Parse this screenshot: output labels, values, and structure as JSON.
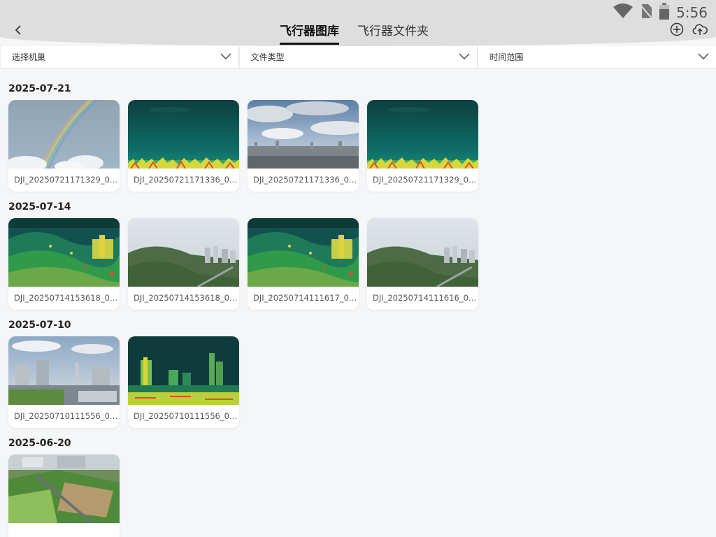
{
  "status": {
    "time": "5:56"
  },
  "header": {
    "tabs": [
      {
        "label": "飞行器图库",
        "active": true
      },
      {
        "label": "飞行器文件夹",
        "active": false
      }
    ],
    "icons": {
      "back": "chevron-left-icon",
      "add": "plus-circle-icon",
      "upload": "cloud-upload-icon"
    }
  },
  "filters": [
    {
      "label": "选择机巢"
    },
    {
      "label": "文件类型"
    },
    {
      "label": "时间范围"
    }
  ],
  "groups": [
    {
      "date": "2025-07-21",
      "items": [
        {
          "name": "DJI_20250721171329_0…",
          "kind": "rainbow"
        },
        {
          "name": "DJI_20250721171336_0…",
          "kind": "thermal-sky"
        },
        {
          "name": "DJI_20250721171336_0…",
          "kind": "city-sky"
        },
        {
          "name": "DJI_20250721171329_0…",
          "kind": "thermal-sky"
        }
      ]
    },
    {
      "date": "2025-07-14",
      "items": [
        {
          "name": "DJI_20250714153618_0…",
          "kind": "thermal-hill"
        },
        {
          "name": "DJI_20250714153618_0…",
          "kind": "hill-city"
        },
        {
          "name": "DJI_20250714111617_0…",
          "kind": "thermal-hill"
        },
        {
          "name": "DJI_20250714111616_0…",
          "kind": "hill-city"
        }
      ]
    },
    {
      "date": "2025-07-10",
      "items": [
        {
          "name": "DJI_20250710111556_0…",
          "kind": "campus"
        },
        {
          "name": "DJI_20250710111556_0…",
          "kind": "thermal-city"
        }
      ]
    },
    {
      "date": "2025-06-20",
      "items": [
        {
          "name": "",
          "kind": "fields"
        }
      ]
    }
  ],
  "colors": {
    "background": "#f5f6f8",
    "header": "#dedede",
    "accent": "#111111"
  }
}
